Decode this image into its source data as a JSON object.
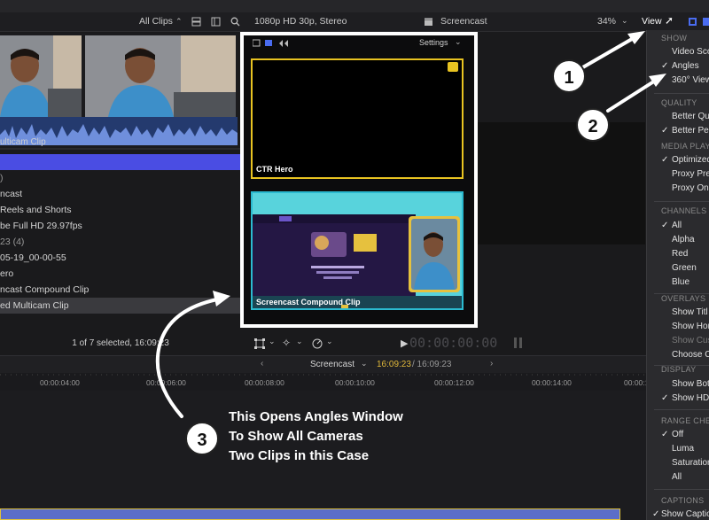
{
  "toolbar": {
    "clips_filter": "All Clips",
    "format": "1080p HD 30p, Stereo",
    "project_name": "Screencast",
    "zoom": "34%",
    "view_button": "View"
  },
  "browser": {
    "wave_label": "ulticam Clip",
    "items": [
      {
        "label": ""
      },
      {
        "label": ")"
      },
      {
        "label": "ncast"
      },
      {
        "label": "Reels and Shorts"
      },
      {
        "label": "be Full HD 29.97fps"
      },
      {
        "label": "23  (4)"
      },
      {
        "label": "05-19_00-00-55"
      },
      {
        "label": "ero"
      },
      {
        "label": "ncast Compound Clip"
      },
      {
        "label": "ed Multicam Clip"
      }
    ],
    "status": "1 of 7 selected, 16:09:23"
  },
  "angles": {
    "settings": "Settings",
    "angle1_label": "CTR Hero",
    "angle2_label": "Screencast Compound Clip"
  },
  "viewer": {
    "timecode": "00:00:00:00"
  },
  "timeline": {
    "name": "Screencast",
    "current": "16:09:23",
    "duration": "/ 16:09:23",
    "ticks": [
      "00:00:04:00",
      "00:00:06:00",
      "00:00:08:00",
      "00:00:10:00",
      "00:00:12:00",
      "00:00:14:00",
      "00:00:16:"
    ]
  },
  "menu": {
    "show_head": "SHOW",
    "video_scopes": "Video Sco",
    "angles": "Angles",
    "view360": "360° View",
    "quality_head": "QUALITY",
    "better_quality": "Better Qu",
    "better_performance": "Better Per",
    "media_head": "MEDIA PLAY",
    "optimized": "Optimized",
    "proxy_preferred": "Proxy Pre",
    "proxy_only": "Proxy Onl",
    "channels_head": "CHANNELS",
    "all": "All",
    "alpha": "Alpha",
    "red": "Red",
    "green": "Green",
    "blue": "Blue",
    "overlays_head": "OVERLAYS",
    "show_title": "Show Titl",
    "show_horizon": "Show Hor",
    "show_custom": "Show Cus",
    "choose": "Choose C",
    "display_head": "DISPLAY",
    "show_both": "Show Bot",
    "show_hdr": "Show HDI",
    "range_head": "RANGE CHE",
    "off": "Off",
    "luma": "Luma",
    "saturation": "Saturation",
    "all2": "All",
    "captions_head": "CAPTIONS",
    "show_captions": "Show Captio"
  },
  "annotations": {
    "badge1": "1",
    "badge2": "2",
    "badge3": "3",
    "note_line1": "This Opens Angles Window",
    "note_line2": "To Show All Cameras",
    "note_line3": "Two Clips in this Case"
  },
  "colors": {
    "selection": "#4a4de3",
    "angle_active": "#e8c321",
    "angle_other": "#2bbad0"
  }
}
